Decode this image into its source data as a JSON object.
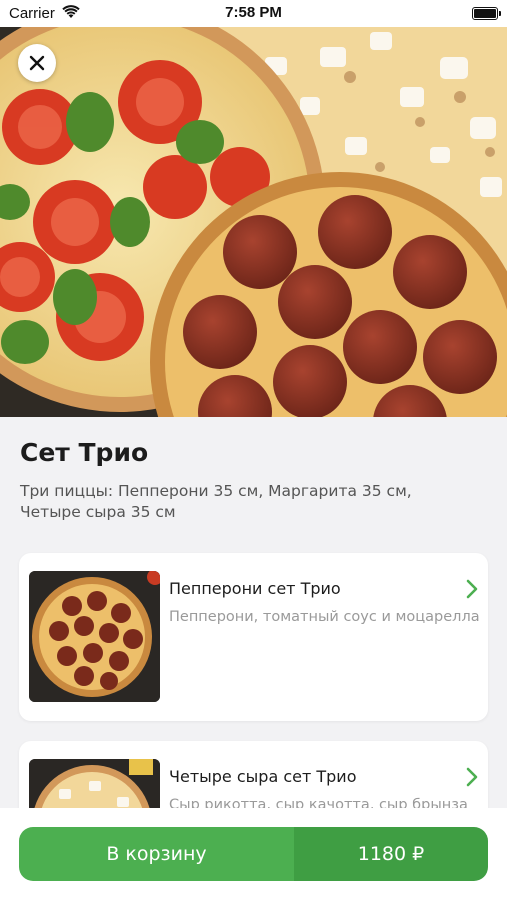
{
  "status_bar": {
    "carrier": "Carrier",
    "time": "7:58 PM",
    "wifi_icon": "wifi-icon",
    "battery_icon": "battery-icon"
  },
  "product": {
    "title": "Сет Трио",
    "description": "Три пиццы: Пепперони 35 см, Маргарита 35 см, Четыре сыра 35 см"
  },
  "items": [
    {
      "title": "Пепперони сет Трио",
      "subtitle": "Пепперони, томатный соус и моцарелла"
    },
    {
      "title": "Четыре сыра сет Трио",
      "subtitle": "Сыр рикотта, сыр качотта, сыр брынза"
    }
  ],
  "cart": {
    "label": "В корзину",
    "price": "1180 ₽"
  },
  "colors": {
    "accent": "#4caf50",
    "accent_dark": "#3f9e43",
    "chevron": "#4caf50",
    "background": "#f2f2f4"
  }
}
